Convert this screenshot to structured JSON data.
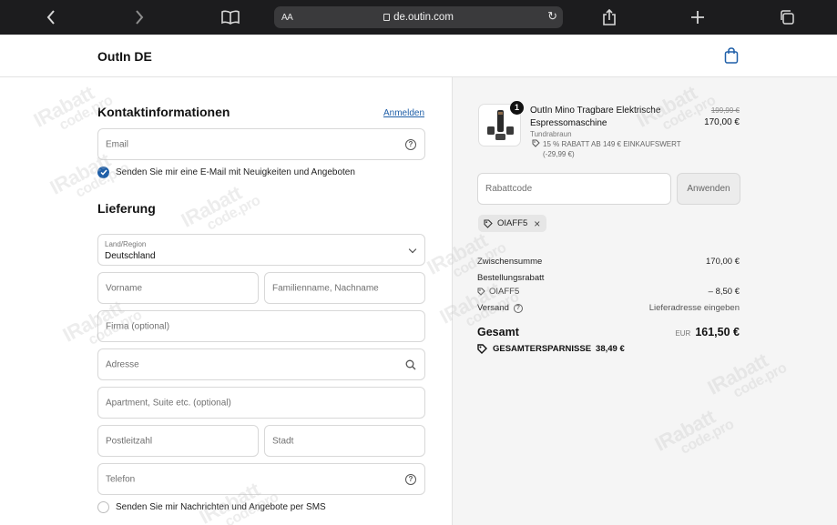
{
  "browser": {
    "text_size_label": "AA",
    "url": "de.outin.com"
  },
  "header": {
    "brand": "OutIn DE"
  },
  "contact": {
    "title": "Kontaktinformationen",
    "login_link": "Anmelden",
    "email_placeholder": "Email",
    "newsletter_label": "Senden Sie mir eine E-Mail mit Neuigkeiten und Angeboten",
    "newsletter_checked": true
  },
  "delivery": {
    "title": "Lieferung",
    "country_label": "Land/Region",
    "country_value": "Deutschland",
    "first_name_placeholder": "Vorname",
    "last_name_placeholder": "Familienname, Nachname",
    "company_placeholder": "Firma (optional)",
    "address_placeholder": "Adresse",
    "apartment_placeholder": "Apartment, Suite etc. (optional)",
    "zip_placeholder": "Postleitzahl",
    "city_placeholder": "Stadt",
    "phone_placeholder": "Telefon",
    "sms_label": "Senden Sie mir Nachrichten und Angebote per SMS",
    "sms_checked": false
  },
  "order": {
    "item": {
      "quantity": "1",
      "name": "OutIn Mino Tragbare Elektrische Espressomaschine",
      "variant": "Tundrabraun",
      "discount_text": "15 % RABATT AB 149 € EINKAUFSWERT (-29,99 €)",
      "price_original": "199,99 €",
      "price": "170,00 €"
    },
    "discount_code_placeholder": "Rabattcode",
    "apply_label": "Anwenden",
    "applied_code": "OIAFF5",
    "subtotal_label": "Zwischensumme",
    "subtotal_value": "170,00 €",
    "order_discount_label": "Bestellungsrabatt",
    "order_discount_code": "OIAFF5",
    "order_discount_value": "– 8,50 €",
    "shipping_label": "Versand",
    "shipping_value": "Lieferadresse eingeben",
    "total_label": "Gesamt",
    "total_currency": "EUR",
    "total_value": "161,50 €",
    "savings_label": "GESAMTERSPARNISSE",
    "savings_value": "38,49 €"
  },
  "watermark": {
    "line1": "IRabatt",
    "line2": "code.pro"
  },
  "colors": {
    "accent": "#1f5fa8",
    "toolbar": "#1c1c1e",
    "sidebar_bg": "#f5f5f5"
  }
}
